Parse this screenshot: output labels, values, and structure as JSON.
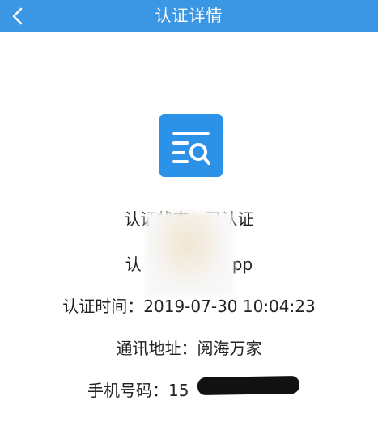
{
  "header": {
    "title": "认证详情",
    "back_icon": "chevron-left-icon",
    "background_color": "#3b97e3"
  },
  "certificate_icon": {
    "icon": "document-search-icon",
    "color": "#2b92e8"
  },
  "details": [
    {
      "label": "认证状态：",
      "value": "已认证"
    },
    {
      "label": "认",
      "value": "pp"
    },
    {
      "label": "认证时间：",
      "value": "2019-07-30 10:04:23"
    },
    {
      "label": "通讯地址：",
      "value": "阅海万家"
    },
    {
      "label": "手机号码：",
      "value": "15"
    }
  ]
}
